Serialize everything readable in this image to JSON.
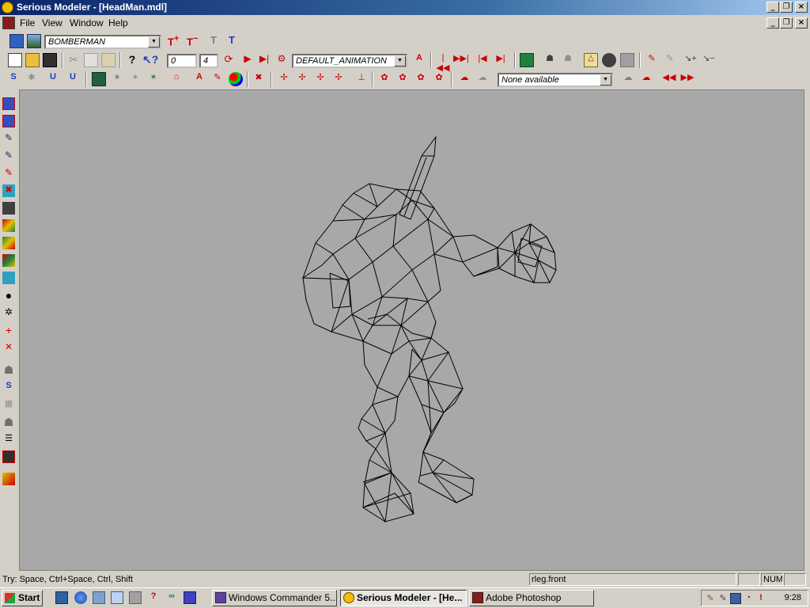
{
  "window": {
    "title": "Serious Modeler - [HeadMan.mdl]"
  },
  "menu": {
    "items": [
      "File",
      "View",
      "Window",
      "Help"
    ]
  },
  "toolbar": {
    "model_select": "BOMBERMAN",
    "frame_start": "0",
    "frame_end": "4",
    "animation_select": "DEFAULT_ANIMATION",
    "attachment_select": "None available"
  },
  "viewport": {
    "mode": "wireframe",
    "line_color": "#000000",
    "background": "#a8a8a8"
  },
  "status": {
    "hint": "Try: Space, Ctrl+Space, Ctrl, Shift",
    "surface": "rleg.front",
    "num": "NUM"
  },
  "taskbar": {
    "start": "Start",
    "tasks": [
      "Windows Commander 5....",
      "Serious Modeler - [He...",
      "Adobe Photoshop"
    ],
    "clock": "9:28"
  },
  "colors": {
    "titlebar": "#0a246a",
    "face": "#d4d0c8",
    "viewport_bg": "#a8a8a8"
  }
}
